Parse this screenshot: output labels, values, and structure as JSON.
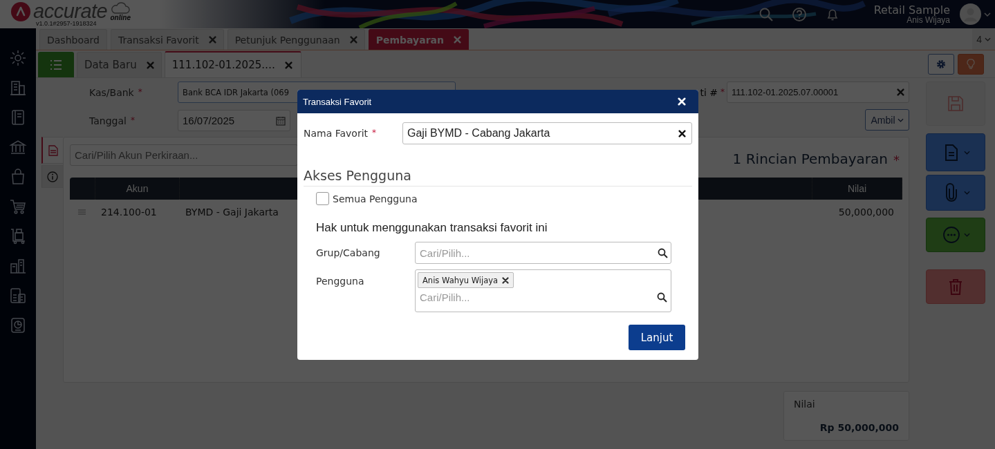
{
  "header": {
    "logo": "accurate",
    "logo_sub": "online",
    "version": "v1.0.1#2957-1918324",
    "company": "Retail Sample",
    "user": "Anis Wijaya"
  },
  "main_tabs": [
    {
      "label": "Dashboard",
      "closable": false,
      "selected": false
    },
    {
      "label": "Transaksi Favorit",
      "closable": true,
      "selected": false
    },
    {
      "label": "Petunjuk Penggunaan",
      "closable": true,
      "selected": false
    },
    {
      "label": "Pembayaran",
      "closable": true,
      "selected": true
    }
  ],
  "tab_count": "4",
  "doc_tabs": [
    {
      "label": "Data Baru",
      "selected": false
    },
    {
      "label": "111.102-01.2025.…",
      "selected": true
    }
  ],
  "form": {
    "fields": [
      {
        "label": "Kas/Bank",
        "mark": "*",
        "value": "Bank BCA IDR Jakarta (069"
      },
      {
        "label": "Tanggal",
        "mark": "*",
        "value": "16/07/2025"
      }
    ],
    "number": {
      "label": "ti #",
      "mark": "*",
      "value": "111.102-01.2025.07.00001"
    },
    "fetch_button": "Ambil"
  },
  "details": {
    "search_placeholder": "Cari/Pilih Akun Perkiraan...",
    "title": "1 Rincian Pembayaran",
    "title_mark": "*",
    "columns": {
      "account": "Akun",
      "value": "Nilai"
    },
    "rows": [
      {
        "account": "214.100-01",
        "name": "BYMD - Gaji Jakarta",
        "value": "50,000,000"
      }
    ]
  },
  "total": {
    "label": "Nilai",
    "value": "Rp 50,000,000"
  },
  "dialog": {
    "title": "Transaksi Favorit",
    "name_label": "Nama Favorit",
    "name_mark": "*",
    "name_value": "Gaji BYMD - Cabang Jakarta",
    "section": "Akses Pengguna",
    "all_users": {
      "label": "Semua Pengguna",
      "checked": false
    },
    "rights_title": "Hak untuk menggunakan transaksi favorit ini",
    "group_label": "Grup/Cabang",
    "group_placeholder": "Cari/Pilih...",
    "user_label": "Pengguna",
    "user_tags": [
      "Anis Wahyu Wijaya"
    ],
    "user_placeholder": "Cari/Pilih...",
    "submit": "Lanjut"
  }
}
